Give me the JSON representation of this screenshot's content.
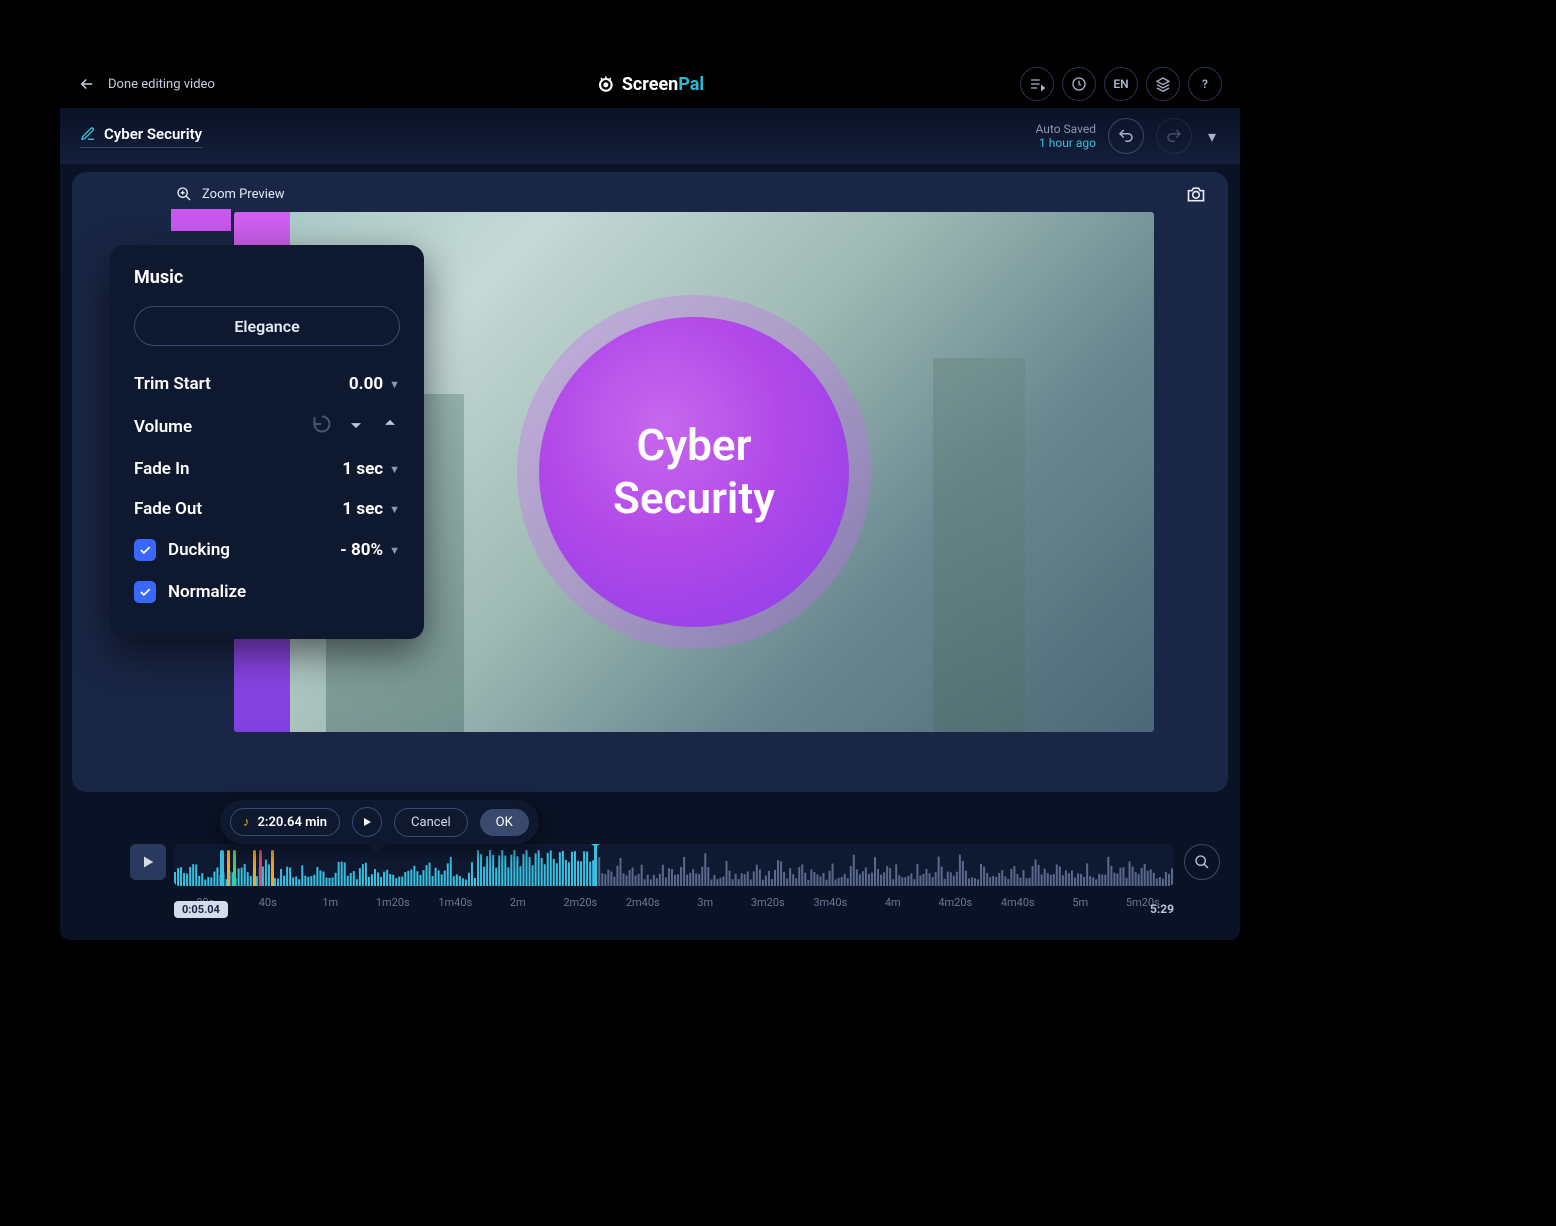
{
  "header": {
    "back_label": "Done editing video",
    "brand_left": "Screen",
    "brand_right": "Pal",
    "lang": "EN"
  },
  "project": {
    "title": "Cyber Security",
    "autosave_label": "Auto Saved",
    "autosave_time": "1 hour ago"
  },
  "preview": {
    "zoom_label": "Zoom Preview",
    "title_text": "Cyber\nSecurity"
  },
  "music_panel": {
    "title": "Music",
    "track_name": "Elegance",
    "trim_start_label": "Trim Start",
    "trim_start_value": "0.00",
    "volume_label": "Volume",
    "fade_in_label": "Fade In",
    "fade_in_value": "1 sec",
    "fade_out_label": "Fade Out",
    "fade_out_value": "1 sec",
    "ducking_label": "Ducking",
    "ducking_value": "- 80%",
    "ducking_checked": true,
    "normalize_label": "Normalize",
    "normalize_checked": true
  },
  "action_bar": {
    "duration": "2:20.64 min",
    "cancel": "Cancel",
    "ok": "OK"
  },
  "timeline": {
    "current_time": "0:05.04",
    "end_time": "5:29",
    "ticks": [
      "20s",
      "40s",
      "1m",
      "1m20s",
      "1m40s",
      "2m",
      "2m20s",
      "2m40s",
      "3m",
      "3m20s",
      "3m40s",
      "4m",
      "4m20s",
      "4m40s",
      "5m",
      "5m20s"
    ]
  },
  "colors": {
    "accent": "#3ac0e0",
    "panel": "#0e182e",
    "bg": "#1a2646"
  }
}
